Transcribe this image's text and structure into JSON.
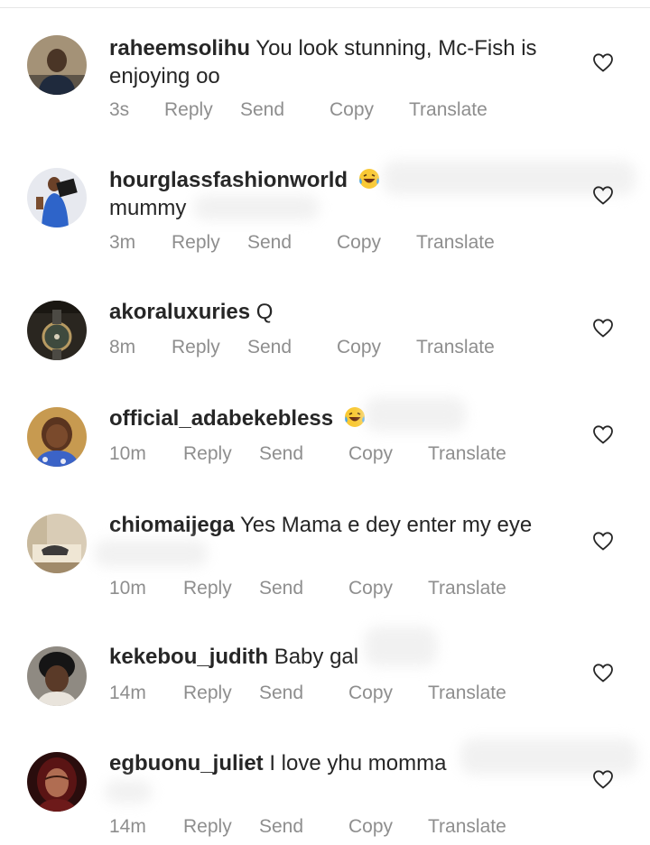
{
  "comments": [
    {
      "username": "raheemsolihu",
      "text": "You look stunning, Mc-Fish is enjoying oo",
      "time": "3s",
      "reply": "Reply",
      "send": "Send",
      "copy": "Copy",
      "translate": "Translate"
    },
    {
      "username": "hourglassfashionworld",
      "text": "mummy",
      "time": "3m",
      "reply": "Reply",
      "send": "Send",
      "copy": "Copy",
      "translate": "Translate"
    },
    {
      "username": "akoraluxuries",
      "text": "Q",
      "time": "8m",
      "reply": "Reply",
      "send": "Send",
      "copy": "Copy",
      "translate": "Translate"
    },
    {
      "username": "official_adabekebless",
      "text": "",
      "time": "10m",
      "reply": "Reply",
      "send": "Send",
      "copy": "Copy",
      "translate": "Translate"
    },
    {
      "username": "chiomaijega",
      "text": "Yes Mama e dey enter my eye",
      "time": "10m",
      "reply": "Reply",
      "send": "Send",
      "copy": "Copy",
      "translate": "Translate"
    },
    {
      "username": "kekebou_judith",
      "text": "Baby gal",
      "time": "14m",
      "reply": "Reply",
      "send": "Send",
      "copy": "Copy",
      "translate": "Translate"
    },
    {
      "username": "egbuonu_juliet",
      "text": "I love yhu momma",
      "time": "14m",
      "reply": "Reply",
      "send": "Send",
      "copy": "Copy",
      "translate": "Translate"
    }
  ],
  "icons": {
    "like": "heart-outline-icon",
    "emoji": "laughing-tears-emoji-icon"
  },
  "colors": {
    "text": "#262626",
    "meta": "#8e8e8e"
  }
}
